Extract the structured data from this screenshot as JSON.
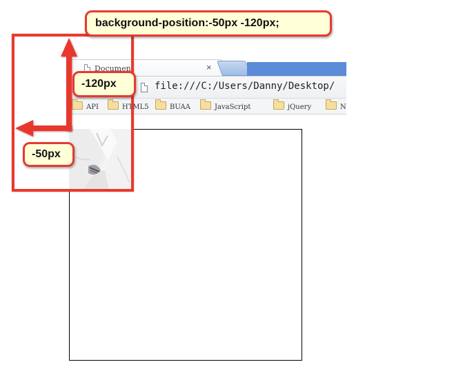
{
  "browser": {
    "tab_title": "Document",
    "tab_close": "×",
    "address": "file:///C:/Users/Danny/Desktop/",
    "bookmarks": [
      "API",
      "HTML5",
      "BUAA",
      "JavaScript",
      "jQuery",
      "N"
    ]
  },
  "annotations": {
    "css_rule": "background-position:-50px -120px;",
    "y_offset": "-120px",
    "x_offset": "-50px"
  },
  "colors": {
    "annotation_red": "#e8392e",
    "callout_fill": "#ffffd8"
  },
  "icons": {
    "tab": "document-icon",
    "address": "document-icon",
    "bookmark": "folder-icon"
  }
}
